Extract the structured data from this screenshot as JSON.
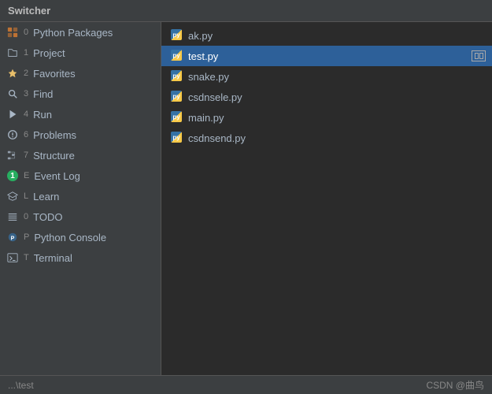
{
  "title": "Switcher",
  "sidebar": {
    "items": [
      {
        "id": "python-packages",
        "shortcut": "0",
        "label": "Python Packages",
        "icon_type": "packages",
        "key_hint": "0"
      },
      {
        "id": "project",
        "shortcut": "1",
        "label": "Project",
        "icon_type": "project",
        "key_hint": "1"
      },
      {
        "id": "favorites",
        "shortcut": "2",
        "label": "Favorites",
        "icon_type": "favorites",
        "key_hint": "2"
      },
      {
        "id": "find",
        "shortcut": "3",
        "label": "Find",
        "icon_type": "find",
        "key_hint": "3"
      },
      {
        "id": "run",
        "shortcut": "4",
        "label": "Run",
        "icon_type": "run",
        "key_hint": "4"
      },
      {
        "id": "problems",
        "shortcut": "6",
        "label": "Problems",
        "icon_type": "problems",
        "key_hint": "6"
      },
      {
        "id": "structure",
        "shortcut": "7",
        "label": "Structure",
        "icon_type": "structure",
        "key_hint": "7"
      },
      {
        "id": "event-log",
        "shortcut": "E",
        "label": "Event Log",
        "icon_type": "eventlog",
        "key_hint": "E"
      },
      {
        "id": "learn",
        "shortcut": "L",
        "label": "Learn",
        "icon_type": "learn",
        "key_hint": "L"
      },
      {
        "id": "todo",
        "shortcut": "0",
        "label": "TODO",
        "icon_type": "todo",
        "key_hint": "0"
      },
      {
        "id": "python-console",
        "shortcut": "P",
        "label": "Python Console",
        "icon_type": "console",
        "key_hint": "P"
      },
      {
        "id": "terminal",
        "shortcut": "T",
        "label": "Terminal",
        "icon_type": "terminal",
        "key_hint": "T"
      }
    ]
  },
  "files": {
    "items": [
      {
        "id": "ak-py",
        "name": "ak.py",
        "selected": false
      },
      {
        "id": "test-py",
        "name": "test.py",
        "selected": true
      },
      {
        "id": "snake-py",
        "name": "snake.py",
        "selected": false
      },
      {
        "id": "csdnsele-py",
        "name": "csdnsele.py",
        "selected": false
      },
      {
        "id": "main-py",
        "name": "main.py",
        "selected": false
      },
      {
        "id": "csdnsend-py",
        "name": "csdnsend.py",
        "selected": false
      }
    ]
  },
  "status": {
    "path": "...\\test",
    "branding": "CSDN @曲鸟"
  }
}
